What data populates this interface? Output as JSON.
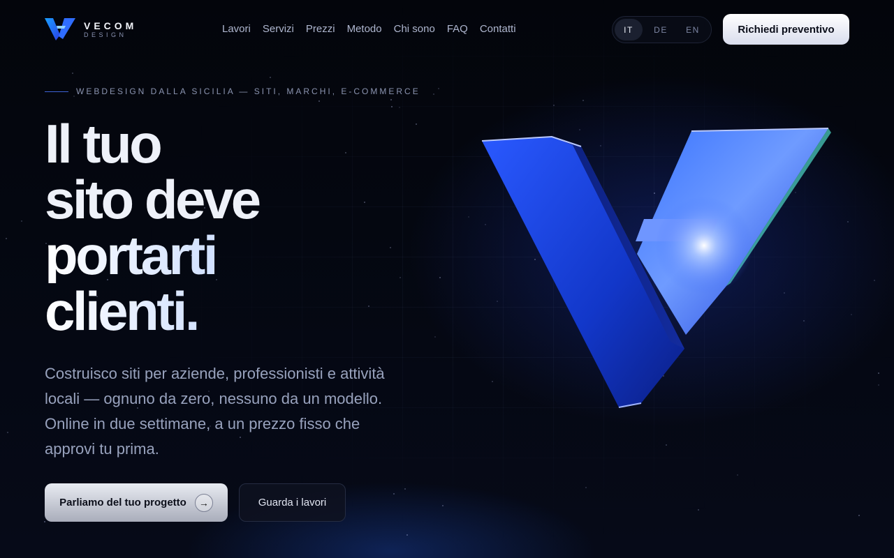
{
  "brand": {
    "name": "VECOM",
    "sub": "DESIGN"
  },
  "nav": {
    "items": [
      "Lavori",
      "Servizi",
      "Prezzi",
      "Metodo",
      "Chi sono",
      "FAQ",
      "Contatti"
    ]
  },
  "lang": {
    "options": [
      "IT",
      "DE",
      "EN"
    ],
    "selected": "IT"
  },
  "header": {
    "cta_label": "Richiedi preventivo"
  },
  "hero": {
    "eyebrow": "WEBDESIGN DALLA SICILIA — SITI, MARCHI, E-COMMERCE",
    "headline": [
      "Il tuo",
      "sito deve",
      "portarti",
      "clienti."
    ],
    "lead": "Costruisco siti per aziende, professionisti e attività locali — ognuno da zero, nessuno da un modello. Online in due settimane, a un prezzo fisso che approvi tu prima.",
    "primary_cta": "Parliamo del tuo progetto",
    "secondary_cta": "Guarda i lavori"
  },
  "colors": {
    "accent": "#2f5bff",
    "background": "#04060d",
    "text": "#eef1f9"
  },
  "icons": {
    "logo": "vecom-v-logo-icon",
    "arrow": "arrow-right-icon",
    "hero_art": "3d-v-logo-icon"
  }
}
